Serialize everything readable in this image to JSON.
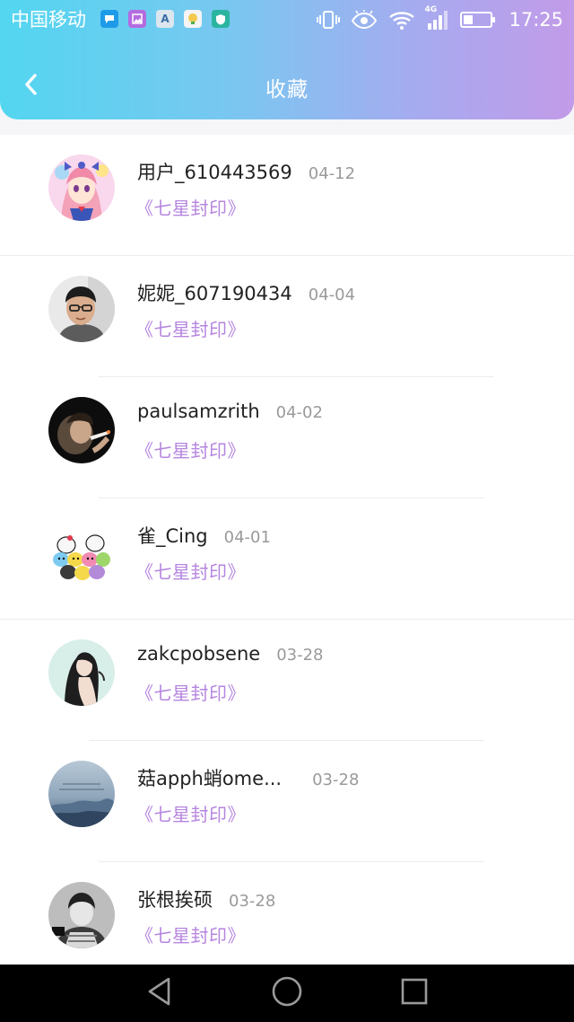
{
  "status_bar": {
    "carrier": "中国移动",
    "network_type": "4G",
    "time": "17:25",
    "notification_icons": [
      "message-icon",
      "gallery-icon",
      "font-icon",
      "reader-icon",
      "shield-icon"
    ]
  },
  "header": {
    "title": "收藏",
    "back_icon": "chevron-left-icon"
  },
  "colors": {
    "gradient_start": "#53d6f0",
    "gradient_end": "#c29be8",
    "book_title": "#b585df",
    "date": "#9a9a9a"
  },
  "favorites": [
    {
      "username": "用户_610443569",
      "date": "04-12",
      "book": "《七星封印》",
      "avatar": "anime-girl-avatar"
    },
    {
      "username": "妮妮_607190434",
      "date": "04-04",
      "book": "《七星封印》",
      "avatar": "man-glasses-avatar"
    },
    {
      "username": "paulsamzrith",
      "date": "04-02",
      "book": "《七星封印》",
      "avatar": "dark-portrait-avatar"
    },
    {
      "username": "雀_Cing",
      "date": "04-01",
      "book": "《七星封印》",
      "avatar": "cartoon-characters-avatar"
    },
    {
      "username": "zakcpobsene",
      "date": "03-28",
      "book": "《七星封印》",
      "avatar": "girl-illustration-avatar"
    },
    {
      "username": "菇apph蛸ome...",
      "date": "03-28",
      "book": "《七星封印》",
      "avatar": "sky-clouds-avatar"
    },
    {
      "username": "张根挨硕",
      "date": "03-28",
      "book": "《七星封印》",
      "avatar": "bw-boy-avatar"
    }
  ],
  "nav_bar": {
    "buttons": [
      "back-triangle-icon",
      "home-circle-icon",
      "recents-square-icon"
    ]
  }
}
